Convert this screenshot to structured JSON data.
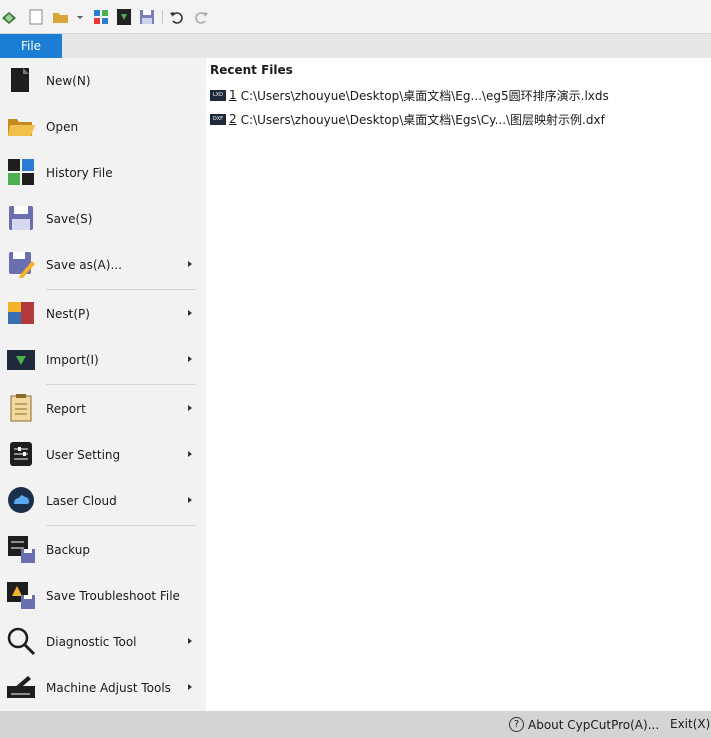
{
  "quick_access": {
    "icons": [
      "app-logo-icon",
      "new-document-icon",
      "open-folder-icon",
      "dropdown-arrow-icon",
      "layout-grid-icon",
      "import-icon",
      "save-icon",
      "undo-icon",
      "redo-icon"
    ]
  },
  "tabs": {
    "file": "File"
  },
  "menu": {
    "items": [
      {
        "label": "New(N)",
        "icon": "new-file-icon"
      },
      {
        "label": "Open",
        "icon": "open-folder-icon"
      },
      {
        "label": "History File",
        "icon": "history-file-icon"
      },
      {
        "label": "Save(S)",
        "icon": "save-icon"
      },
      {
        "label": "Save as(A)...",
        "icon": "save-as-icon"
      },
      {
        "label": "Nest(P)",
        "icon": "nest-icon"
      },
      {
        "label": "Import(I)",
        "icon": "import-icon"
      },
      {
        "label": "Report",
        "icon": "report-icon"
      },
      {
        "label": "User Setting",
        "icon": "user-setting-icon"
      },
      {
        "label": "Laser Cloud",
        "icon": "laser-cloud-icon"
      },
      {
        "label": "Backup",
        "icon": "backup-icon"
      },
      {
        "label": "Save Troubleshoot File",
        "icon": "troubleshoot-file-icon"
      },
      {
        "label": "Diagnostic Tool",
        "icon": "diagnostic-tool-icon"
      },
      {
        "label": "Machine Adjust Tools",
        "icon": "machine-adjust-icon"
      }
    ]
  },
  "recent": {
    "title": "Recent Files",
    "files": [
      {
        "num": "1",
        "badge": "LXD",
        "path": "C:\\Users\\zhouyue\\Desktop\\桌面文档\\Eg...\\eg5圆环排序演示.lxds"
      },
      {
        "num": "2",
        "badge": "DXF",
        "path": "C:\\Users\\zhouyue\\Desktop\\桌面文档\\Egs\\Cy...\\图层映射示例.dxf"
      }
    ]
  },
  "status": {
    "about": "About CypCutPro(A)...",
    "exit": "Exit(X)"
  },
  "colors": {
    "accent": "#1a7fd4",
    "menu_bg": "#f2f2f2",
    "status_bg": "#d4d4d4"
  }
}
